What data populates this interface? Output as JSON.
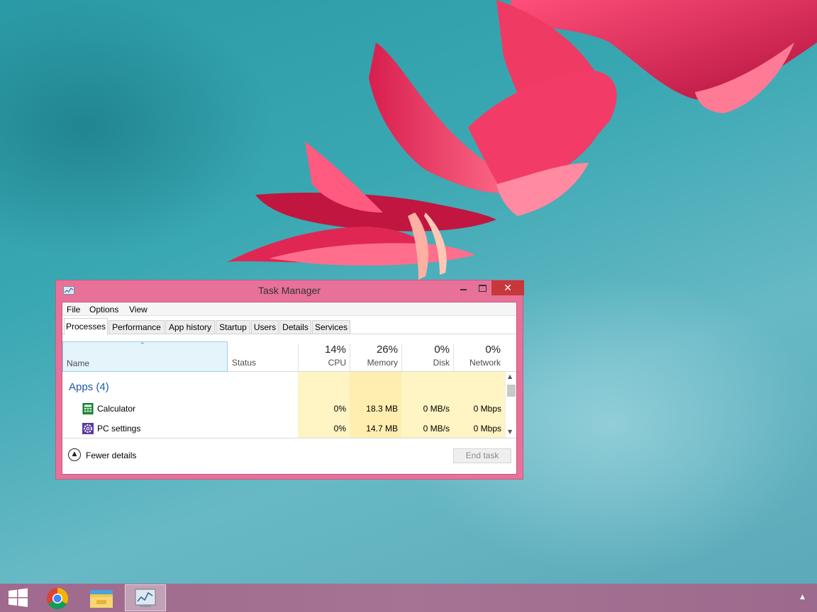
{
  "window": {
    "title": "Task Manager",
    "close_glyph": "✕"
  },
  "menu": [
    "File",
    "Options",
    "View"
  ],
  "tabs": [
    "Processes",
    "Performance",
    "App history",
    "Startup",
    "Users",
    "Details",
    "Services"
  ],
  "active_tab": "Processes",
  "columns": {
    "name": "Name",
    "status": "Status",
    "cpu": {
      "pct": "14%",
      "label": "CPU"
    },
    "memory": {
      "pct": "26%",
      "label": "Memory"
    },
    "disk": {
      "pct": "0%",
      "label": "Disk"
    },
    "network": {
      "pct": "0%",
      "label": "Network"
    }
  },
  "groups": [
    {
      "title": "Apps (4)",
      "rows": [
        {
          "name": "Calculator",
          "icon": "calculator-icon",
          "cpu": "0%",
          "memory": "18.3 MB",
          "disk": "0 MB/s",
          "network": "0 Mbps"
        },
        {
          "name": "PC settings",
          "icon": "settings-gear-icon",
          "cpu": "0%",
          "memory": "14.7 MB",
          "disk": "0 MB/s",
          "network": "0 Mbps"
        }
      ]
    }
  ],
  "footer": {
    "fewer_details": "Fewer details",
    "end_task": "End task"
  },
  "taskbar": {
    "items": [
      "start-button",
      "chrome",
      "file-explorer",
      "task-manager"
    ],
    "active": "task-manager"
  },
  "colors": {
    "window_frame": "#e87199",
    "close_button": "#c7383b",
    "selected_header": "#e5f3fb",
    "heat_light": "#fff4c4",
    "heat_medium": "#ffe9a0",
    "group_title": "#1e5aa8"
  }
}
